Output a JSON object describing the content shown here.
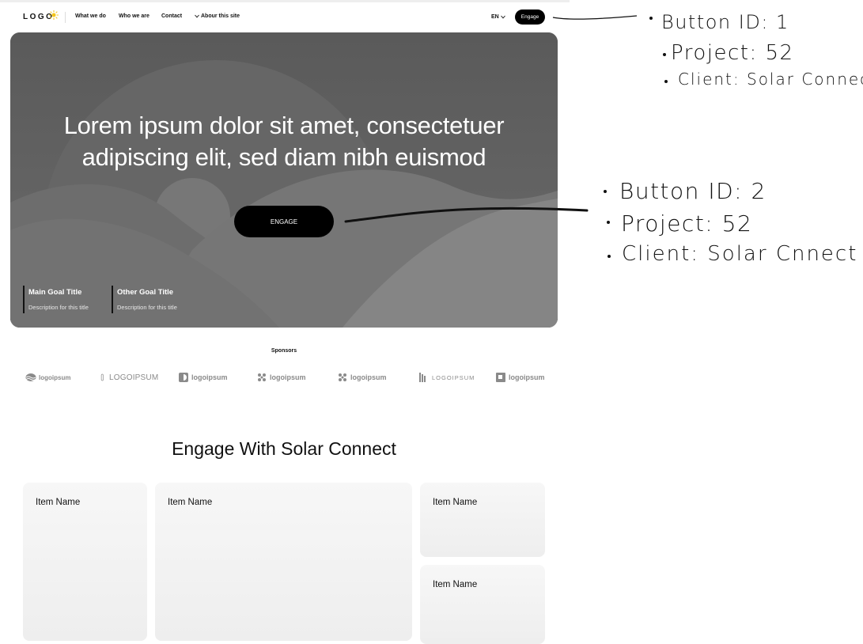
{
  "nav": {
    "logo": "LOGO",
    "links": [
      "What we do",
      "Who we are",
      "Contact",
      "Abour this site"
    ],
    "language": "EN",
    "engage_button": "Engage"
  },
  "hero": {
    "title_line1": "Lorem ipsum dolor sit amet, consectetuer",
    "title_line2": "adipiscing elit, sed diam nibh euismod",
    "button": "ENGAGE",
    "goals": [
      {
        "title": "Main Goal Title",
        "description": "Description for this title"
      },
      {
        "title": "Other Goal Title",
        "description": "Description for this title"
      }
    ]
  },
  "sponsors": {
    "label": "Sponsors",
    "logos": [
      "logoipsum",
      "LOGOIPSUM",
      "logoipsum",
      "logoipsum",
      "logoipsum",
      "LOGOIPSUM",
      "logoipsum"
    ]
  },
  "engage_section": {
    "title": "Engage With Solar Connect",
    "cards": [
      "Item Name",
      "Item Name",
      "Item Name",
      "Item Name"
    ]
  },
  "annotations": {
    "note1": {
      "line1": "Button ID: 1",
      "line2": "Project: 52",
      "line3": "Client: Solar Connect"
    },
    "note2": {
      "line1": "Button ID: 2",
      "line2": "Project: 52",
      "line3": "Client: Solar Cnnect"
    }
  },
  "colors": {
    "hero_bg": "#5e5e5e",
    "button": "#000000",
    "sun": "#f5c518",
    "sponsor_gray": "#8a8a8a"
  }
}
